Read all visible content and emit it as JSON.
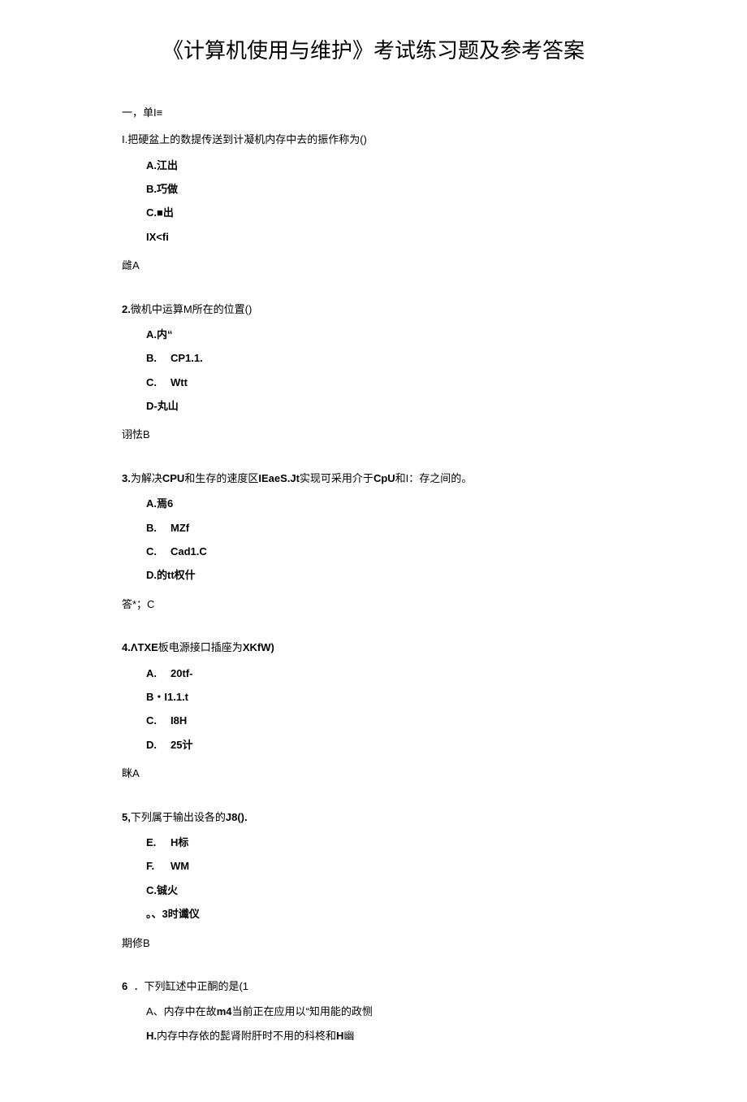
{
  "title": "《计算机使用与维护》考试练习题及参考答案",
  "sectionHeader": "一，单I≡",
  "q1": {
    "text": "I.把硬盆上的数提传送到计凝机内存中去的振作称为()",
    "a": "A.江出",
    "b": "B.巧做",
    "c": "C.■出",
    "d": "IX<fi",
    "ans": "雌A"
  },
  "q2": {
    "num": "2.",
    "text": "微机中运算M所在的位置()",
    "a": "A.内“",
    "bLabel": "B.",
    "bVal": "CP1.1.",
    "cLabel": "C.",
    "cVal": "Wtt",
    "d": "D-丸山",
    "ans": "诩怯B"
  },
  "q3": {
    "num": "3.",
    "text1": "为解决",
    "bold1": "CPU",
    "text2": "和生存的速度区",
    "bold2": "IEaeS.Jt",
    "text3": "实现可采用介于",
    "bold3": "CpU",
    "text4": "和I：存之间的。",
    "a": "A.焉6",
    "bLabel": "B.",
    "bVal": "MZf",
    "cLabel": "C.",
    "cVal": "Cad1.C",
    "d": "D.的tt权什",
    "ans": "答*；C"
  },
  "q4": {
    "text1": "4.ΛTXE",
    "text2": "板电源接口插座为",
    "text3": "XKfW)",
    "aLabel": "A.",
    "aVal": "20tf-",
    "b": "B・I1.1.t",
    "cLabel": "C.",
    "cVal": "I8H",
    "dLabel": "D.",
    "dVal": "25计",
    "ans": "眯A"
  },
  "q5": {
    "num": "5,",
    "text1": "下列属于输出设各的",
    "bold1": "J8().",
    "eLabel": "E.",
    "eVal": "H标",
    "fLabel": "F.",
    "fVal": "WM",
    "c": "C.铖火",
    "d": "。、3时谶仪",
    "ans": "期修B"
  },
  "q6": {
    "num": "6",
    "text": "．下列缸述中正酮的是(1",
    "a1": "A、",
    "a2": "内存中在故",
    "a3": "m4",
    "a4": "当前正在应用以“知用能的政恻",
    "b1": "H.",
    "b2": "内存中存依的髭肾附肝时不用的科柊和",
    "b3": "H",
    "b4": "幽"
  }
}
